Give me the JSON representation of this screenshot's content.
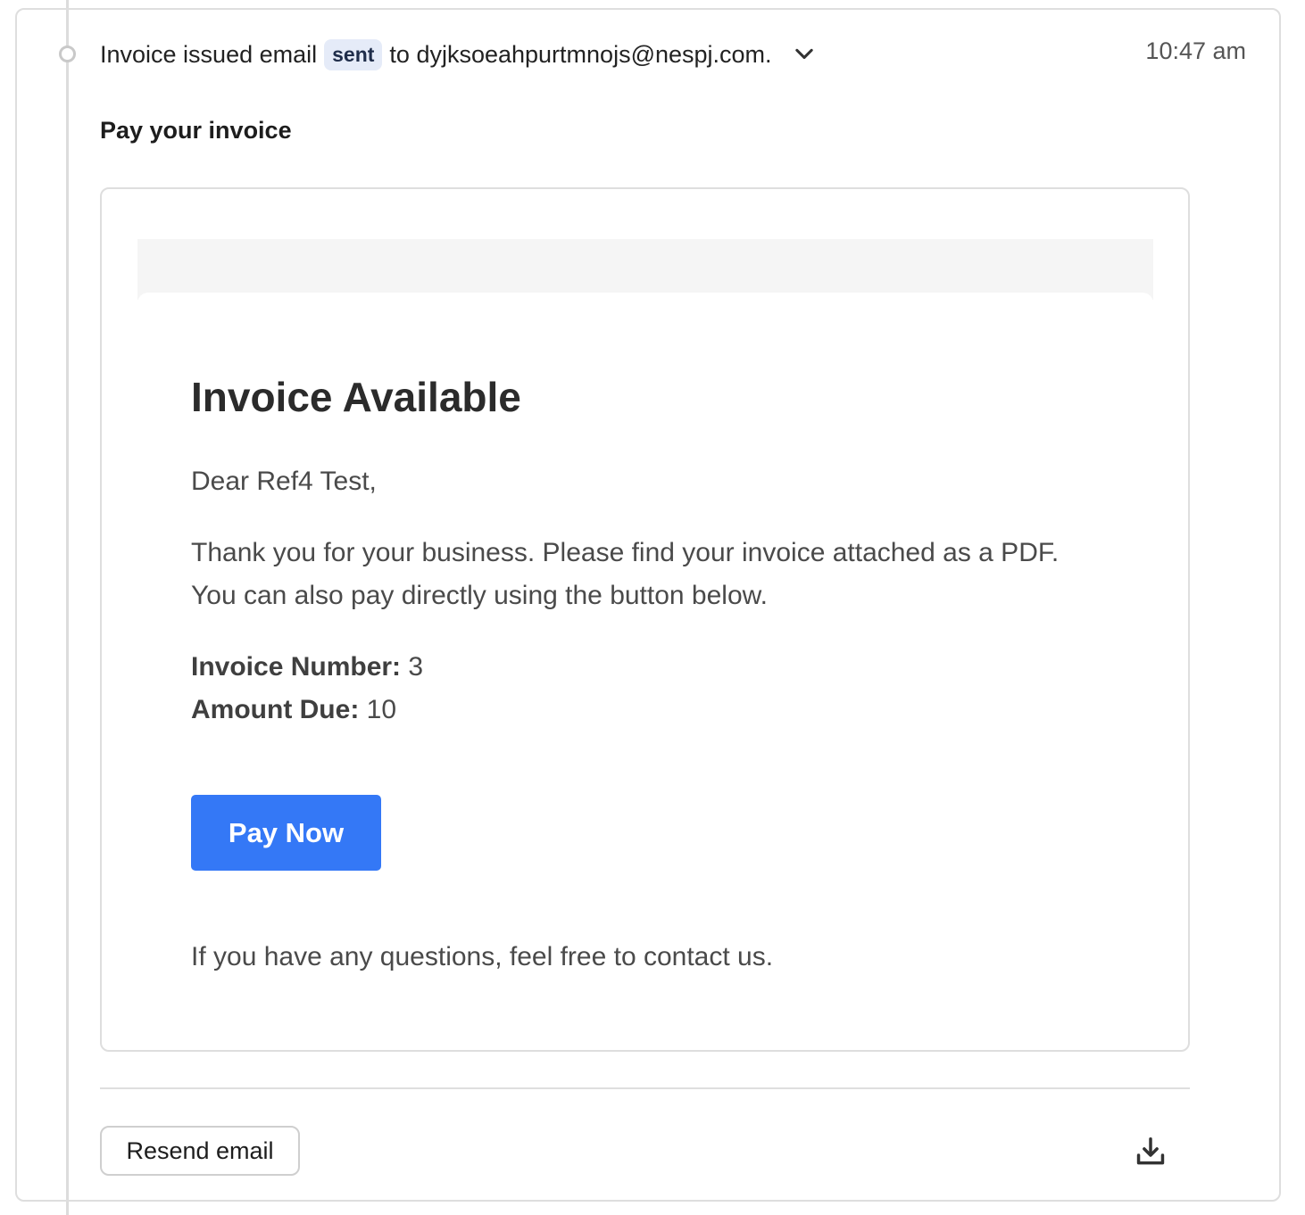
{
  "event": {
    "prefix": "Invoice issued email",
    "badge": "sent",
    "recipient_text": "to dyjksoeahpurtmnojs@nespj.com.",
    "time": "10:47 am"
  },
  "subject": "Pay your invoice",
  "email": {
    "title": "Invoice Available",
    "greeting": "Dear Ref4 Test,",
    "message": "Thank you for your business. Please find your invoice attached as a PDF. You can also pay directly using the button below.",
    "invoice_number_label": "Invoice Number:",
    "invoice_number": "3",
    "amount_due_label": "Amount Due:",
    "amount_due": "10",
    "pay_button": "Pay Now",
    "closing": "If you have any questions, feel free to contact us."
  },
  "actions": {
    "resend_label": "Resend email",
    "download_icon": "download-icon"
  },
  "colors": {
    "accent": "#3478f6",
    "badge_bg": "#e5ebf8",
    "border": "#dedede"
  }
}
